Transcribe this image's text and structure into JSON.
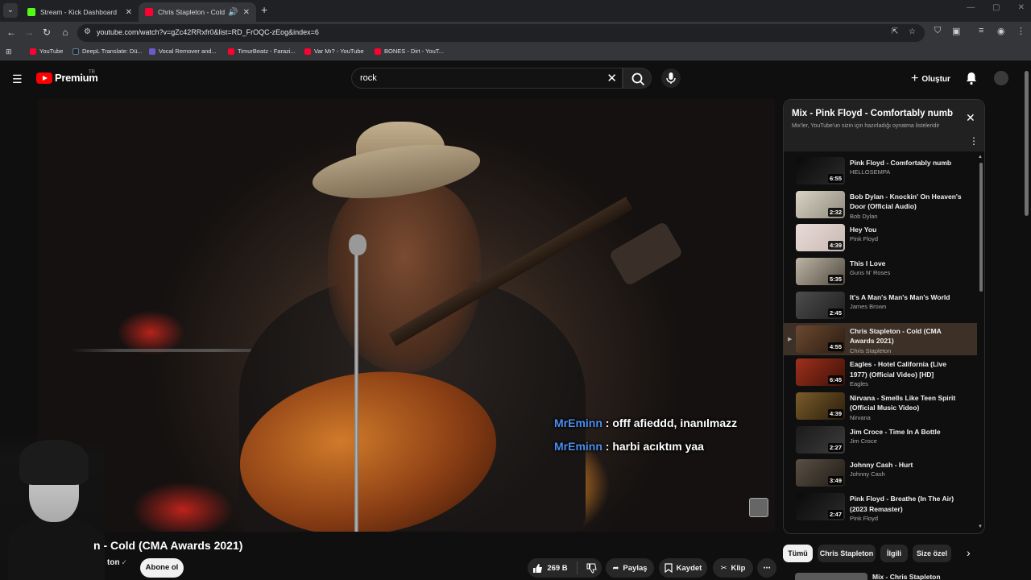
{
  "browser": {
    "tabs": [
      {
        "title": "Stream - Kick Dashboard",
        "fav": "#53fc18"
      },
      {
        "title": "Chris Stapleton - Cold (CMA",
        "fav": "#ff0033"
      }
    ],
    "url": "youtube.com/watch?v=gZc42RRxfr0&list=RD_FrOQC-zEog&index=6",
    "bookmarks": [
      {
        "label": "YouTube",
        "fav": "#ff0033"
      },
      {
        "label": "DeepL Translate: Dü...",
        "fav": "#0f2b46"
      },
      {
        "label": "Vocal Remover and...",
        "fav": "#6a5acd"
      },
      {
        "label": "TimurBeatz - Farazi...",
        "fav": "#ff0033"
      },
      {
        "label": "Var Mı? - YouTube",
        "fav": "#ff0033"
      },
      {
        "label": "BONES - Dirt - YouT...",
        "fav": "#ff0033"
      }
    ]
  },
  "youtube": {
    "logo_text": "Premium",
    "logo_region": "TR",
    "search_value": "rock",
    "create_label": "Oluştur"
  },
  "player": {
    "chat": [
      {
        "user": "MrEminn",
        "message": " : offf afieddd, inanılmazz"
      },
      {
        "user": "MrEminn",
        "message": " : harbi acıktım yaa"
      }
    ]
  },
  "video": {
    "title": "n - Cold (CMA Awards 2021)",
    "channel": "ton",
    "subscribe_label": "Abone ol",
    "likes": "269 B",
    "share_label": "Paylaş",
    "save_label": "Kaydet",
    "clip_label": "Klip"
  },
  "playlist": {
    "title": "Mix - Pink Floyd - Comfortably numb",
    "subtitle": "Mix'ler, YouTube'un sizin için hazırladığı oynatma listeleridir",
    "items": [
      {
        "title": "Pink Floyd - Comfortably numb",
        "channel": "HELLOSEMPA",
        "duration": "6:55",
        "colors": [
          "#0a0a0a",
          "#2a2a2a"
        ]
      },
      {
        "title": "Bob Dylan - Knockin' On Heaven's Door (Official Audio)",
        "channel": "Bob Dylan",
        "duration": "2:32",
        "colors": [
          "#d9d3c4",
          "#8f8a7d"
        ]
      },
      {
        "title": "Hey You",
        "channel": "Pink Floyd",
        "duration": "4:39",
        "colors": [
          "#e8dcd8",
          "#c9b7b2"
        ]
      },
      {
        "title": "This I Love",
        "channel": "Guns N' Roses",
        "duration": "5:35",
        "colors": [
          "#bdb6a6",
          "#514a40"
        ]
      },
      {
        "title": "It's A Man's Man's Man's World",
        "channel": "James Brown",
        "duration": "2:45",
        "colors": [
          "#4d4d4d",
          "#1f1f1f"
        ]
      },
      {
        "title": "Chris Stapleton - Cold (CMA Awards 2021)",
        "channel": "Chris Stapleton",
        "duration": "4:55",
        "colors": [
          "#6b4a30",
          "#2b1c12"
        ]
      },
      {
        "title": "Eagles - Hotel California (Live 1977) (Official Video) [HD]",
        "channel": "Eagles",
        "duration": "6:45",
        "colors": [
          "#a0301c",
          "#3d1208"
        ]
      },
      {
        "title": "Nirvana - Smells Like Teen Spirit (Official Music Video)",
        "channel": "Nirvana",
        "duration": "4:39",
        "colors": [
          "#7a5c2a",
          "#2a1e0c"
        ]
      },
      {
        "title": "Jim Croce - Time In A Bottle",
        "channel": "Jim Croce",
        "duration": "2:27",
        "colors": [
          "#1a1a1a",
          "#3c3c3c"
        ]
      },
      {
        "title": "Johnny Cash - Hurt",
        "channel": "Johnny Cash",
        "duration": "3:49",
        "colors": [
          "#5a5044",
          "#201c17"
        ]
      },
      {
        "title": "Pink Floyd - Breathe (In The Air) (2023 Remaster)",
        "channel": "Pink Floyd",
        "duration": "2:47",
        "colors": [
          "#0a0a0a",
          "#2a2a2a"
        ]
      }
    ],
    "active_index": 5
  },
  "chips": [
    "Tümü",
    "Chris Stapleton",
    "İlgili",
    "Size özel"
  ],
  "next_item_title": "Mix - Chris Stapleton"
}
